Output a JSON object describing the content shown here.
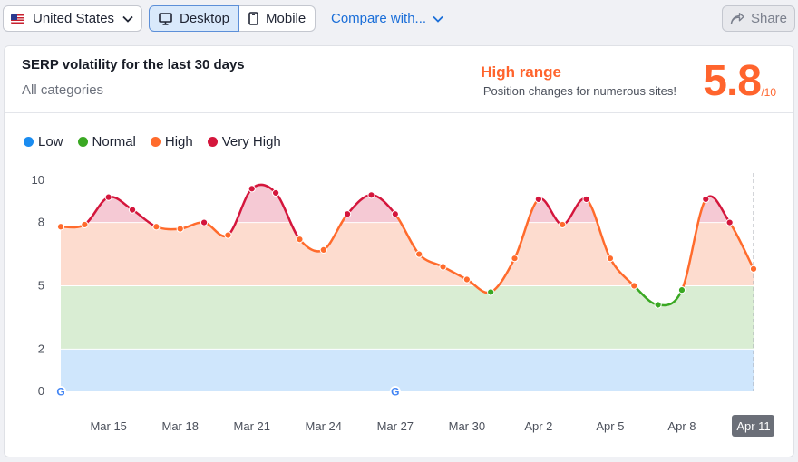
{
  "toolbar": {
    "country": "United States",
    "device_desktop": "Desktop",
    "device_mobile": "Mobile",
    "compare": "Compare with...",
    "share": "Share"
  },
  "card": {
    "title": "SERP volatility for the last 30 days",
    "subtitle": "All categories",
    "range_label": "High range",
    "range_desc": "Position changes for numerous sites!",
    "score": "5.8",
    "score_max": "/10"
  },
  "legend": [
    {
      "label": "Low",
      "color": "#1a8cf0"
    },
    {
      "label": "Normal",
      "color": "#3aa823"
    },
    {
      "label": "High",
      "color": "#ff6b2c"
    },
    {
      "label": "Very High",
      "color": "#d4163c"
    }
  ],
  "chart_data": {
    "type": "area",
    "y_ticks": [
      0,
      2,
      5,
      8,
      10
    ],
    "ylim": [
      0,
      10
    ],
    "x_tick_labels": [
      "Mar 15",
      "Mar 18",
      "Mar 21",
      "Mar 24",
      "Mar 27",
      "Mar 30",
      "Apr 2",
      "Apr 5",
      "Apr 8",
      "Apr 11"
    ],
    "x_tick_days": [
      2,
      5,
      8,
      11,
      14,
      17,
      20,
      23,
      26,
      29
    ],
    "bands": [
      {
        "name": "Low",
        "from": 0,
        "to": 2,
        "color": "#cfe6fc"
      },
      {
        "name": "Normal",
        "from": 2,
        "to": 5,
        "color": "#d9edd3"
      },
      {
        "name": "High",
        "from": 5,
        "to": 8,
        "color": "#fddccf"
      },
      {
        "name": "Very High",
        "from": 8,
        "to": 10,
        "color": "#f5c9d4"
      }
    ],
    "days": [
      "Mar 13",
      "Mar 14",
      "Mar 15",
      "Mar 16",
      "Mar 17",
      "Mar 18",
      "Mar 19",
      "Mar 20",
      "Mar 21",
      "Mar 22",
      "Mar 23",
      "Mar 24",
      "Mar 25",
      "Mar 26",
      "Mar 27",
      "Mar 28",
      "Mar 29",
      "Mar 30",
      "Mar 31",
      "Apr 1",
      "Apr 2",
      "Apr 3",
      "Apr 4",
      "Apr 5",
      "Apr 6",
      "Apr 7",
      "Apr 8",
      "Apr 9",
      "Apr 10",
      "Apr 11"
    ],
    "values": [
      7.8,
      7.9,
      9.2,
      8.6,
      7.8,
      7.7,
      8.0,
      7.4,
      9.6,
      9.4,
      7.2,
      6.7,
      8.4,
      9.3,
      8.4,
      6.5,
      5.9,
      5.3,
      4.7,
      6.3,
      9.1,
      7.9,
      9.1,
      6.3,
      5.0,
      4.1,
      4.8,
      9.1,
      8.0,
      5.8
    ],
    "google_update_days": [
      0,
      14
    ],
    "highlight_label": "Apr 11"
  }
}
